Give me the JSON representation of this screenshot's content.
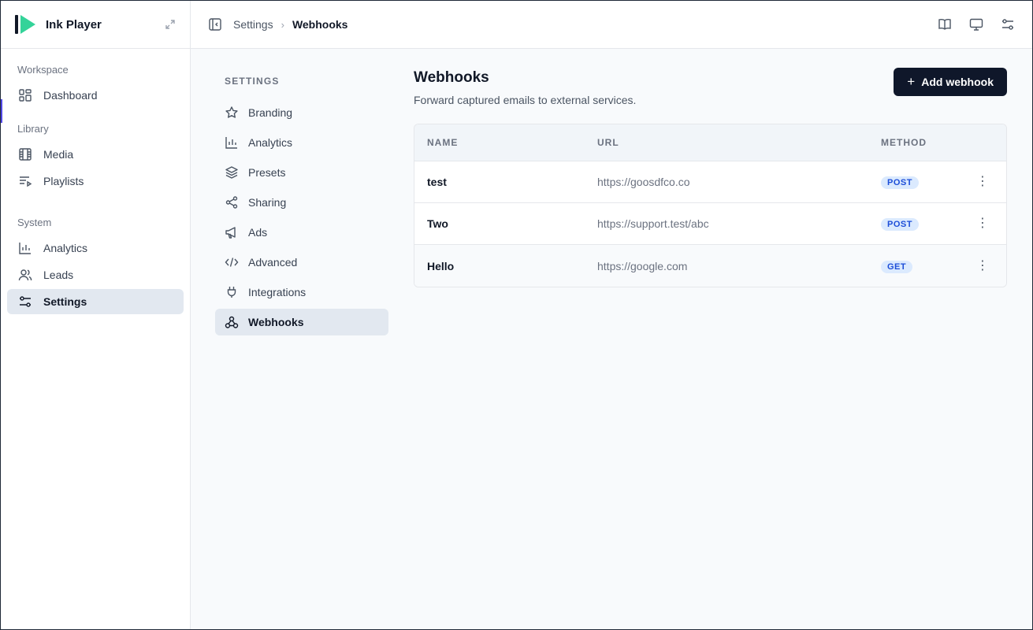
{
  "app": {
    "name": "Ink Player"
  },
  "sidebar": {
    "sections": [
      {
        "label": "Workspace",
        "items": [
          {
            "label": "Dashboard",
            "icon": "dashboard-icon"
          }
        ]
      },
      {
        "label": "Library",
        "items": [
          {
            "label": "Media",
            "icon": "film-icon"
          },
          {
            "label": "Playlists",
            "icon": "playlist-icon"
          }
        ]
      },
      {
        "label": "System",
        "items": [
          {
            "label": "Analytics",
            "icon": "bar-chart-icon"
          },
          {
            "label": "Leads",
            "icon": "users-icon"
          },
          {
            "label": "Settings",
            "icon": "sliders-icon",
            "active": true
          }
        ]
      }
    ]
  },
  "breadcrumb": {
    "parent": "Settings",
    "current": "Webhooks"
  },
  "settings_nav": {
    "title": "SETTINGS",
    "items": [
      {
        "label": "Branding",
        "icon": "star-icon"
      },
      {
        "label": "Analytics",
        "icon": "bar-chart-icon"
      },
      {
        "label": "Presets",
        "icon": "layers-icon"
      },
      {
        "label": "Sharing",
        "icon": "share-icon"
      },
      {
        "label": "Ads",
        "icon": "megaphone-icon"
      },
      {
        "label": "Advanced",
        "icon": "code-icon"
      },
      {
        "label": "Integrations",
        "icon": "plug-icon"
      },
      {
        "label": "Webhooks",
        "icon": "webhook-icon",
        "active": true
      }
    ]
  },
  "panel": {
    "title": "Webhooks",
    "subtitle": "Forward captured emails to external services.",
    "add_button": "Add webhook"
  },
  "table": {
    "headers": {
      "name": "NAME",
      "url": "URL",
      "method": "METHOD"
    },
    "rows": [
      {
        "name": "test",
        "url": "https://goosdfco.co",
        "method": "POST"
      },
      {
        "name": "Two",
        "url": "https://support.test/abc",
        "method": "POST"
      },
      {
        "name": "Hello",
        "url": "https://google.com",
        "method": "GET"
      }
    ]
  },
  "colors": {
    "accent": "#0f172a",
    "badge_text": "#1d4ed8",
    "badge_bg": "#dbeafe",
    "logo_green": "#34d399"
  }
}
